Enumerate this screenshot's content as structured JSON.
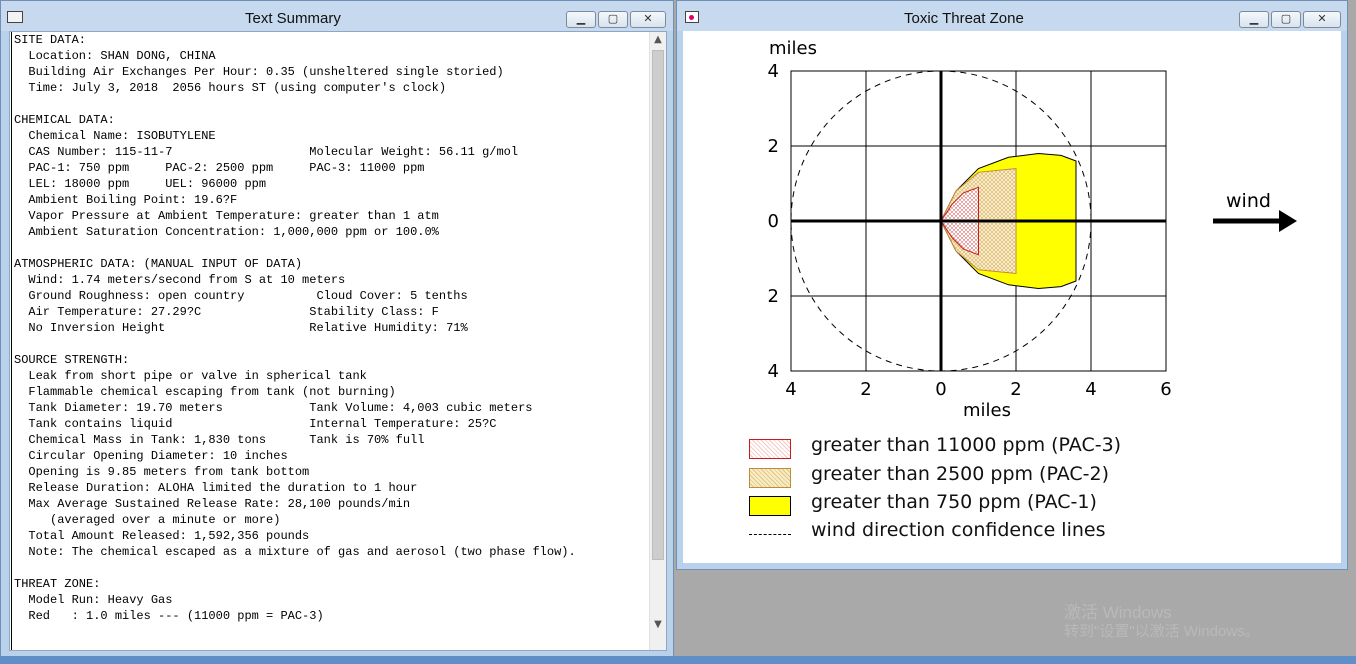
{
  "text_summary": {
    "title": "Text Summary",
    "icon_label": "TEXT",
    "lines": [
      "SITE DATA:",
      "  Location: SHAN DONG, CHINA",
      "  Building Air Exchanges Per Hour: 0.35 (unsheltered single storied)",
      "  Time: July 3, 2018  2056 hours ST (using computer's clock)",
      "",
      "CHEMICAL DATA:",
      "  Chemical Name: ISOBUTYLENE",
      "  CAS Number: 115-11-7                   Molecular Weight: 56.11 g/mol",
      "  PAC-1: 750 ppm     PAC-2: 2500 ppm     PAC-3: 11000 ppm",
      "  LEL: 18000 ppm     UEL: 96000 ppm",
      "  Ambient Boiling Point: 19.6?F",
      "  Vapor Pressure at Ambient Temperature: greater than 1 atm",
      "  Ambient Saturation Concentration: 1,000,000 ppm or 100.0%",
      "",
      "ATMOSPHERIC DATA: (MANUAL INPUT OF DATA)",
      "  Wind: 1.74 meters/second from S at 10 meters",
      "  Ground Roughness: open country          Cloud Cover: 5 tenths",
      "  Air Temperature: 27.29?C               Stability Class: F",
      "  No Inversion Height                    Relative Humidity: 71%",
      "",
      "SOURCE STRENGTH:",
      "  Leak from short pipe or valve in spherical tank",
      "  Flammable chemical escaping from tank (not burning)",
      "  Tank Diameter: 19.70 meters            Tank Volume: 4,003 cubic meters",
      "  Tank contains liquid                   Internal Temperature: 25?C",
      "  Chemical Mass in Tank: 1,830 tons      Tank is 70% full",
      "  Circular Opening Diameter: 10 inches",
      "  Opening is 9.85 meters from tank bottom",
      "  Release Duration: ALOHA limited the duration to 1 hour",
      "  Max Average Sustained Release Rate: 28,100 pounds/min",
      "     (averaged over a minute or more)",
      "  Total Amount Released: 1,592,356 pounds",
      "  Note: The chemical escaped as a mixture of gas and aerosol (two phase flow).",
      "",
      "THREAT ZONE:",
      "  Model Run: Heavy Gas",
      "  Red   : 1.0 miles --- (11000 ppm = PAC-3)"
    ]
  },
  "threat_zone": {
    "title": "Toxic Threat Zone",
    "y_unit_label": "miles",
    "x_unit_label": "miles",
    "y_ticks": [
      "4",
      "2",
      "0",
      "2",
      "4"
    ],
    "x_ticks": [
      "4",
      "2",
      "0",
      "2",
      "4",
      "6"
    ],
    "wind_label": "wind",
    "legend": [
      {
        "label": "greater than 11000 ppm (PAC-3)",
        "swatch": "red-dotted"
      },
      {
        "label": "greater than 2500 ppm (PAC-2)",
        "swatch": "orange-dotted"
      },
      {
        "label": "greater than 750 ppm (PAC-1)",
        "swatch": "yellow"
      },
      {
        "label": "wind direction confidence lines",
        "swatch": "dashed"
      }
    ]
  },
  "window_buttons": {
    "minimize": "▁",
    "maximize": "▢",
    "close": "✕"
  },
  "watermark": [
    "激活 Windows",
    "转到\"设置\"以激活 Windows。"
  ],
  "colors": {
    "pac3_outline": "#c41e1e",
    "pac2_fill": "#f4e7b8",
    "pac1_fill": "#ffff00",
    "titlebar": "#c6d9ee",
    "frame": "#b9d1ea"
  },
  "chart_data": {
    "type": "area",
    "xlim": [
      -4,
      6
    ],
    "ylim": [
      -4,
      4
    ],
    "xlabel": "miles",
    "ylabel": "miles",
    "grid": true,
    "legend_placement": "bottom",
    "series": [
      {
        "name": "greater than 750 ppm (PAC-1)",
        "x": [
          0,
          0.4,
          1.0,
          1.8,
          2.6,
          3.2,
          3.6,
          3.6,
          3.2,
          2.6,
          1.8,
          1.0,
          0.4,
          0
        ],
        "y": [
          0,
          0.8,
          1.4,
          1.7,
          1.8,
          1.75,
          1.6,
          -1.6,
          -1.75,
          -1.8,
          -1.7,
          -1.4,
          -0.8,
          0
        ]
      },
      {
        "name": "greater than 2500 ppm (PAC-2)",
        "x": [
          0,
          0.4,
          1.0,
          2.0,
          2.0,
          1.0,
          0.4,
          0
        ],
        "y": [
          0,
          0.8,
          1.3,
          1.4,
          -1.4,
          -1.3,
          -0.8,
          0
        ]
      },
      {
        "name": "greater than 11000 ppm (PAC-3)",
        "x": [
          0,
          0.3,
          0.6,
          1.0,
          1.0,
          0.6,
          0.3,
          0
        ],
        "y": [
          0,
          0.45,
          0.75,
          0.9,
          -0.9,
          -0.75,
          -0.45,
          0
        ]
      }
    ],
    "confidence_circle_radius": 4
  }
}
